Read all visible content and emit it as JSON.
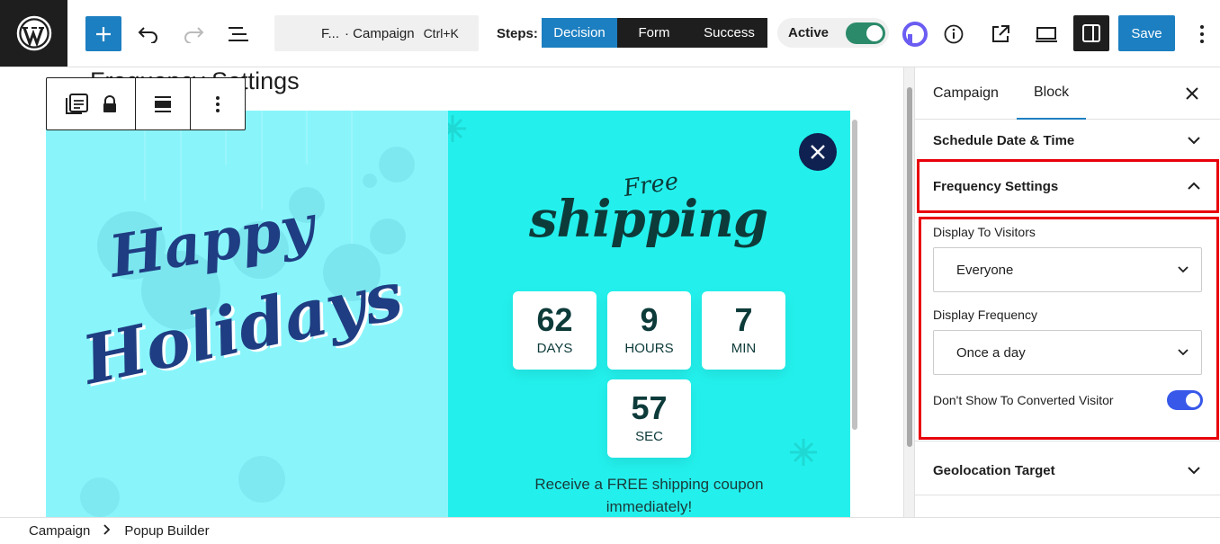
{
  "toolbar": {
    "command_title": "F...",
    "command_subtitle": "· Campaign",
    "command_shortcut": "Ctrl+K",
    "steps_label": "Steps:",
    "steps": [
      "Decision",
      "Form",
      "Success"
    ],
    "active_step": "Decision",
    "status_label": "Active",
    "status_on": true,
    "save_label": "Save",
    "accent_color": "#1c7fc1"
  },
  "canvas": {
    "heading": "Frequency Settings",
    "popup": {
      "left_line1": "Happy",
      "left_line2": "Holidays",
      "right_small": "Free",
      "right_big": "shipping",
      "countdown": [
        {
          "value": "62",
          "unit": "DAYS"
        },
        {
          "value": "9",
          "unit": "HOURS"
        },
        {
          "value": "7",
          "unit": "MIN"
        },
        {
          "value": "57",
          "unit": "SEC"
        }
      ],
      "promo_line1": "Receive a FREE shipping coupon",
      "promo_line2": "immediately!"
    }
  },
  "panel": {
    "tabs": [
      "Campaign",
      "Block"
    ],
    "active_tab": "Block",
    "sections": {
      "schedule": "Schedule Date & Time",
      "frequency": "Frequency Settings",
      "geolocation": "Geolocation Target"
    },
    "display_to_visitors_label": "Display To Visitors",
    "display_to_visitors_value": "Everyone",
    "display_frequency_label": "Display Frequency",
    "display_frequency_value": "Once a day",
    "dont_show_label": "Don't Show To Converted Visitor",
    "dont_show_on": true
  },
  "breadcrumb": [
    "Campaign",
    "Popup Builder"
  ]
}
